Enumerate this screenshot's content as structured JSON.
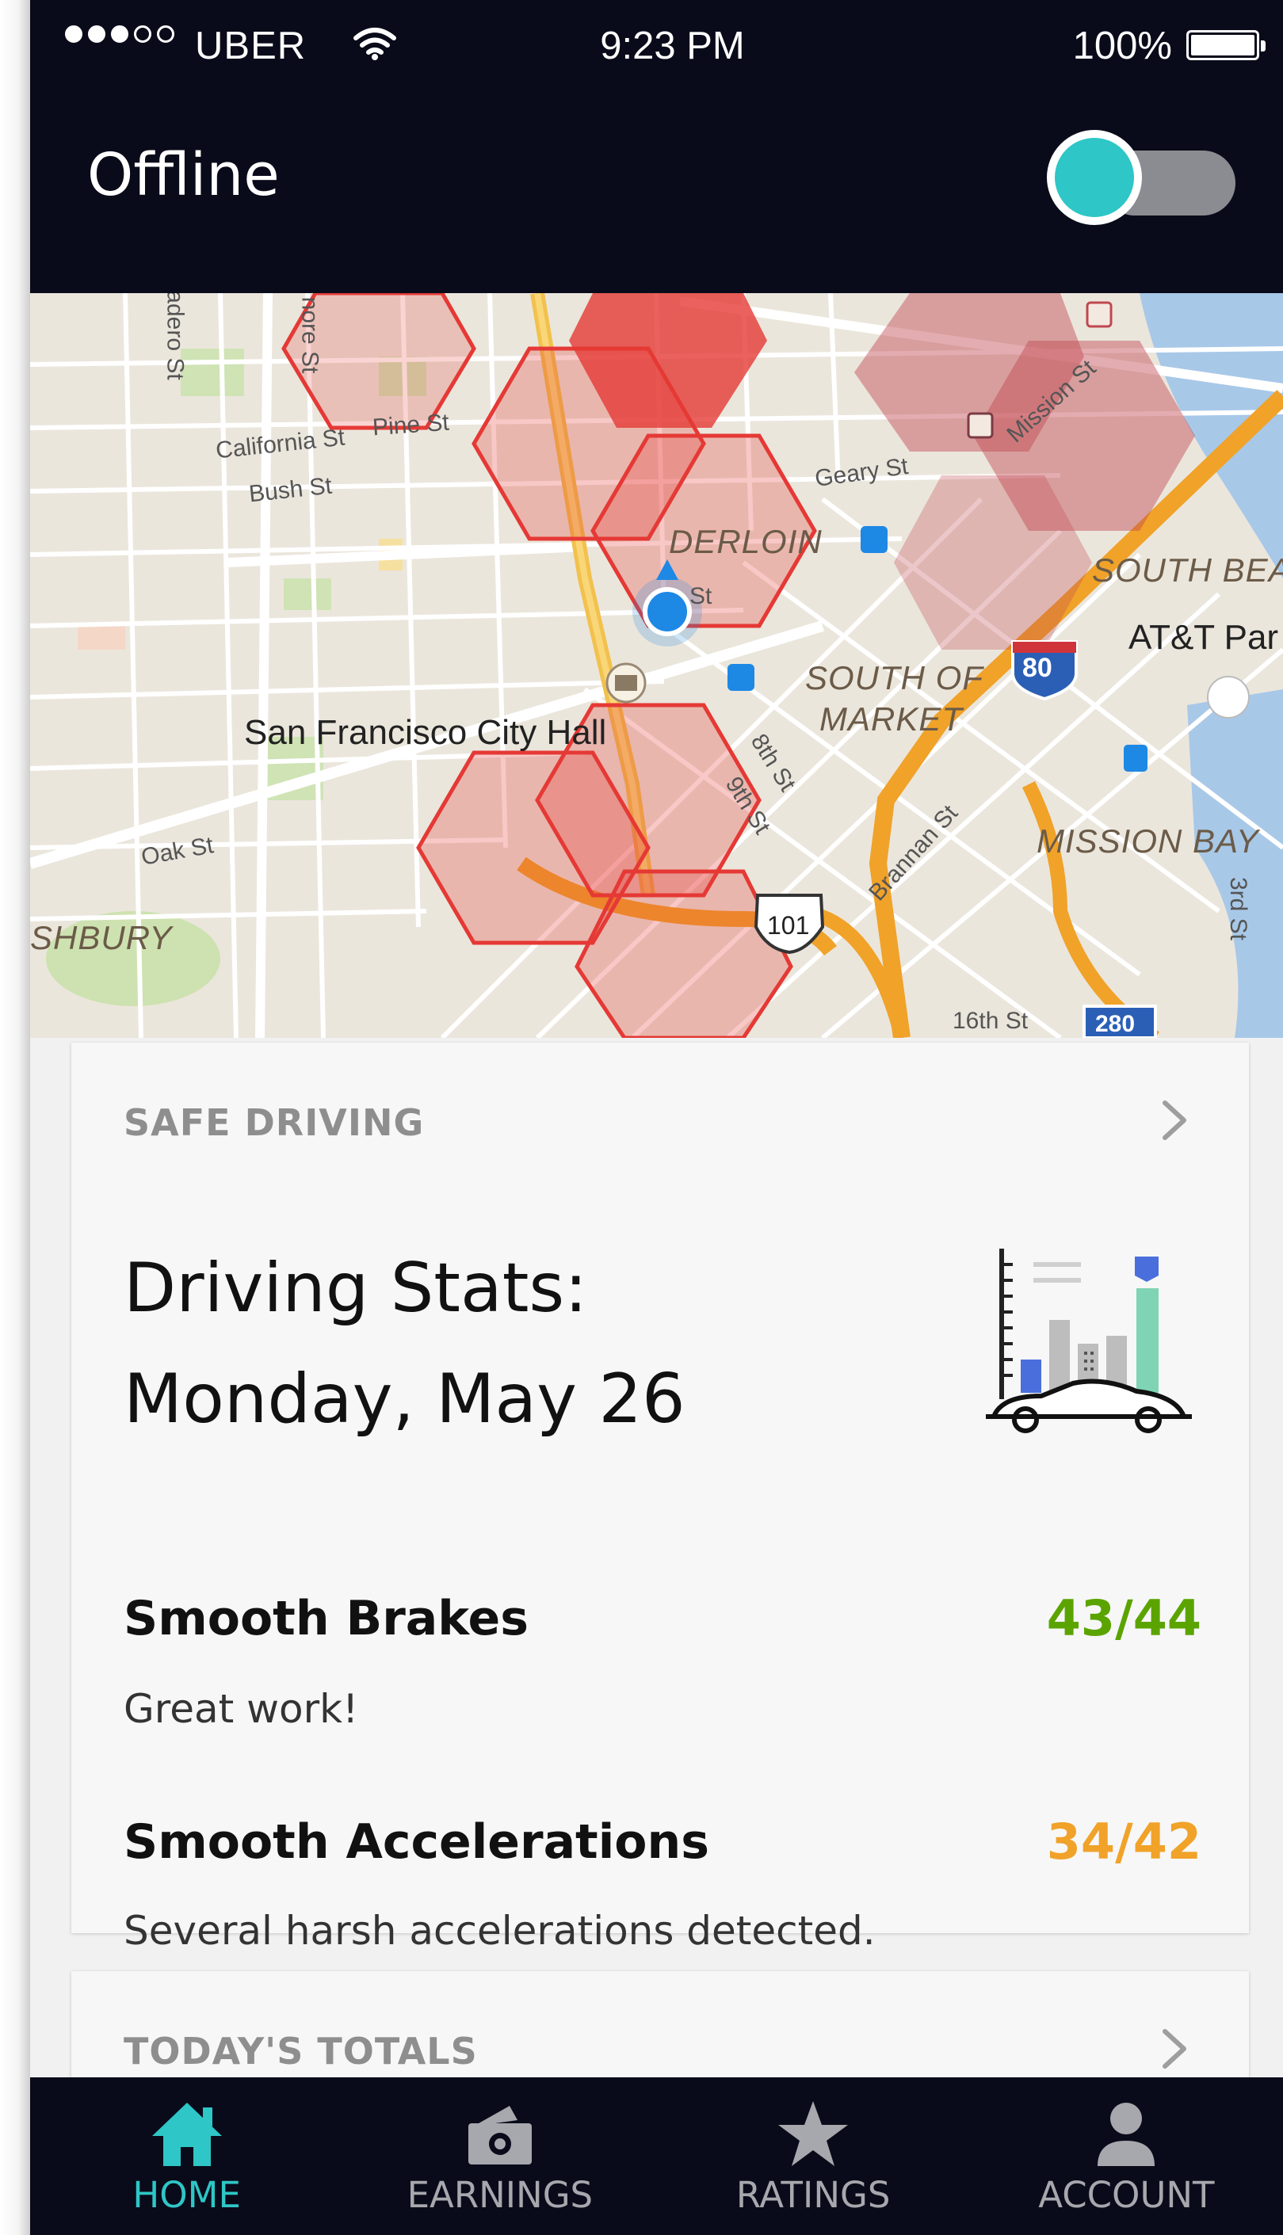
{
  "status_bar": {
    "carrier": "UBER",
    "time": "9:23 PM",
    "battery_percent": "100%",
    "signal_bars_filled": 3,
    "signal_bars_total": 5
  },
  "header": {
    "title": "Offline",
    "toggle_on": true,
    "toggle_color": "#2ec6c6"
  },
  "map": {
    "street_labels": [
      "Pine St",
      "California St",
      "Bush St",
      "Geary St",
      "Mission St",
      "8th St",
      "9th St",
      "Brannan St",
      "Oak St",
      "16th St",
      "3rd St",
      "St"
    ],
    "neighborhood_labels": [
      "DERLOIN",
      "SOUTH BEAC",
      "SOUTH OF",
      "MARKET",
      "MISSION BAY",
      "SHBURY"
    ],
    "poi_labels": [
      "San Francisco City Hall",
      "AT&T Par"
    ],
    "highway_shields": [
      "80",
      "101",
      "280"
    ],
    "edge_street_labels": [
      "adero St",
      "nore St"
    ]
  },
  "safe_driving_card": {
    "section_title": "SAFE DRIVING",
    "title_line1": "Driving Stats:",
    "title_line2": "Monday, May 26",
    "metrics": [
      {
        "name": "Smooth Brakes",
        "score": "43/44",
        "note": "Great work!",
        "color": "#5ba400"
      },
      {
        "name": "Smooth Accelerations",
        "score": "34/42",
        "note": "Several harsh accelerations detected.",
        "color": "#f0a229"
      }
    ]
  },
  "totals_card": {
    "section_title": "TODAY'S TOTALS"
  },
  "bottom_nav": {
    "items": [
      {
        "label": "HOME",
        "icon": "home-icon",
        "active": true
      },
      {
        "label": "EARNINGS",
        "icon": "wallet-icon",
        "active": false
      },
      {
        "label": "RATINGS",
        "icon": "star-icon",
        "active": false
      },
      {
        "label": "ACCOUNT",
        "icon": "person-icon",
        "active": false
      }
    ]
  },
  "colors": {
    "header_bg": "#0a0b1a",
    "accent": "#2ec6c6",
    "surge_red": "#e53935"
  }
}
